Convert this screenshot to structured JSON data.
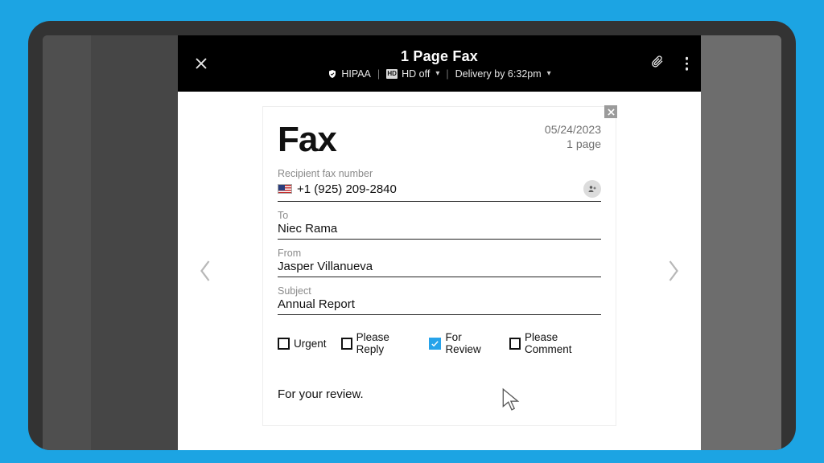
{
  "header": {
    "title": "1 Page Fax",
    "hipaa": "HIPAA",
    "hd_chip": "HD",
    "hd_label": "HD off",
    "delivery": "Delivery by 6:32pm"
  },
  "page": {
    "title": "Fax",
    "date": "05/24/2023",
    "pages": "1 page",
    "fields": {
      "recipient_label": "Recipient fax number",
      "recipient_value": "+1 (925) 209-2840",
      "to_label": "To",
      "to_value": "Niec Rama",
      "from_label": "From",
      "from_value": "Jasper Villanueva",
      "subject_label": "Subject",
      "subject_value": "Annual Report"
    },
    "checks": {
      "urgent": "Urgent",
      "reply": "Please Reply",
      "review": "For Review",
      "comment": "Please Comment",
      "checked": "review"
    },
    "body": "For your review."
  }
}
